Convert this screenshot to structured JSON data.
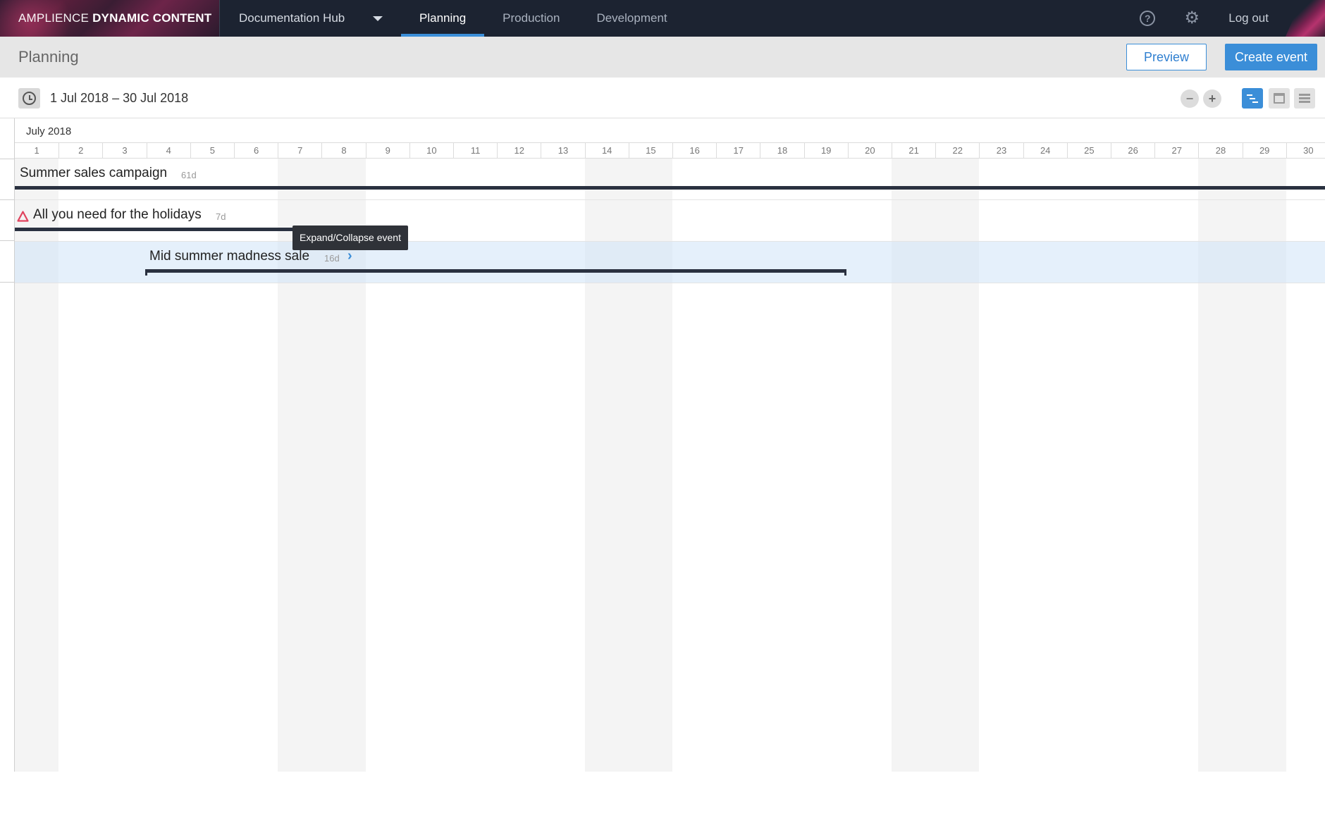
{
  "nav": {
    "brand_light": "AMPLIENCE",
    "brand_bold": "DYNAMIC CONTENT",
    "hub_name": "Documentation Hub",
    "tabs": [
      {
        "label": "Planning"
      },
      {
        "label": "Production"
      },
      {
        "label": "Development"
      }
    ],
    "help_glyph": "?",
    "logout_label": "Log out"
  },
  "header": {
    "title": "Planning",
    "preview_label": "Preview",
    "create_label": "Create event"
  },
  "toolbar": {
    "date_range": "1 Jul 2018 – 30 Jul 2018",
    "zoom_out": "−",
    "zoom_in": "+"
  },
  "calendar": {
    "month": "July 2018",
    "days": [
      "1",
      "2",
      "3",
      "4",
      "5",
      "6",
      "7",
      "8",
      "9",
      "10",
      "11",
      "12",
      "13",
      "14",
      "15",
      "16",
      "17",
      "18",
      "19",
      "20",
      "21",
      "22",
      "23",
      "24",
      "25",
      "26",
      "27",
      "28",
      "29",
      "30"
    ],
    "weekend_days": [
      1,
      7,
      8,
      14,
      15,
      21,
      22,
      28,
      29
    ]
  },
  "events": [
    {
      "name": "Summer sales campaign",
      "duration": "61d",
      "warning": false
    },
    {
      "name": "All you need for the holidays",
      "duration": "7d",
      "warning": true
    },
    {
      "name": "Mid summer madness sale",
      "duration": "16d",
      "warning": false
    }
  ],
  "tooltip": {
    "text": "Expand/Collapse event"
  },
  "colors": {
    "accent": "#3b8ed8",
    "nav_bg": "#1c2331",
    "warning": "#e0435e"
  }
}
